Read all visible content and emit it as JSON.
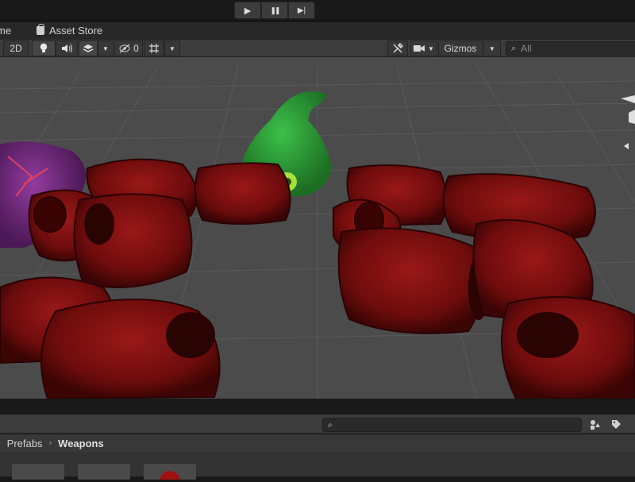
{
  "play_toolbar": {
    "play": "▶",
    "pause": "❚❚",
    "step": "▶|"
  },
  "tabs": {
    "scene_label": "me",
    "asset_store_label": "Asset Store"
  },
  "scene_toolbar": {
    "mode_2d": "2D",
    "hidden_count": "0",
    "gizmos_label": "Gizmos",
    "search_placeholder": "All"
  },
  "project": {
    "breadcrumb": {
      "first": "Prefabs",
      "current": "Weapons"
    }
  },
  "colors": {
    "accent_red": "#8a1414",
    "accent_green": "#2e9e3a"
  }
}
